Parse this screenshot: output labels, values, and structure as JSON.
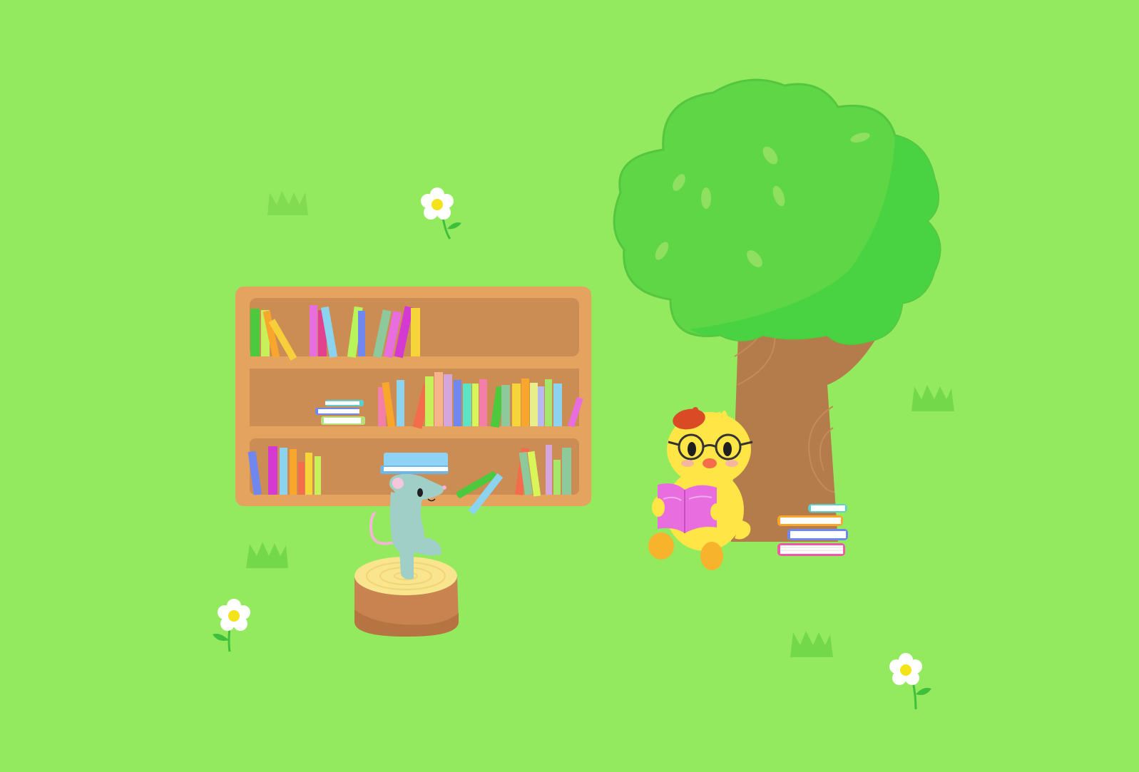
{
  "scene": {
    "kind": "illustration",
    "palette": {
      "grass": "#94ea5f",
      "grass_tuft": "#74d94a",
      "tree_canopy": "#5fd646",
      "tree_canopy_shade": "#49d342",
      "tree_trunk": "#b47b4b",
      "shelf_frame": "#e4a35e",
      "shelf_back": "#cc8d54",
      "stump_top": "#f9e58e",
      "stump_side": "#c88350",
      "mouse": "#9fcfc7",
      "chick": "#ffe545",
      "chick_beret": "#d94a25",
      "book_pink": "#e86ee0",
      "flower_center": "#f4e21a"
    },
    "elements": [
      "bookshelf-with-books",
      "mouse-on-stump",
      "tree",
      "chick-reading",
      "book-stack",
      "flowers",
      "grass-tufts"
    ]
  }
}
